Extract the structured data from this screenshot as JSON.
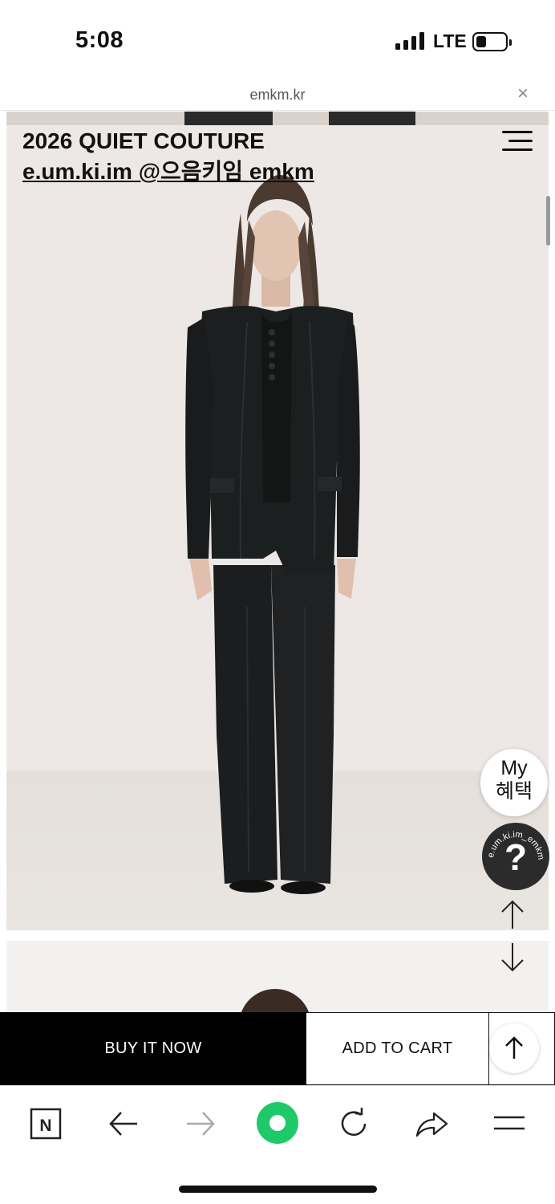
{
  "status_bar": {
    "time": "5:08",
    "network": "LTE"
  },
  "url_bar": {
    "domain": "emkm.kr",
    "close_glyph": "×"
  },
  "header": {
    "title": "2026 QUIET COUTURE",
    "brand": "e.um.ki.im @으음키임 emkm"
  },
  "floating": {
    "benefit_line1": "My",
    "benefit_line2": "혜택",
    "help_ring_text": "e.um.ki.im_emkm",
    "help_glyph": "?"
  },
  "actions": {
    "buy_now": "BUY IT NOW",
    "add_to_cart": "ADD TO CART"
  },
  "colors": {
    "accent_green": "#1ec96a",
    "buy_bg": "#000000",
    "backdrop": "#ede8e5",
    "garment": "#1c1f1f"
  },
  "icons": {
    "naver": "naver-n-icon",
    "back": "arrow-left-icon",
    "forward": "arrow-right-icon",
    "home": "green-circle-icon",
    "reload": "reload-icon",
    "share": "share-icon",
    "menu": "hamburger-icon"
  }
}
